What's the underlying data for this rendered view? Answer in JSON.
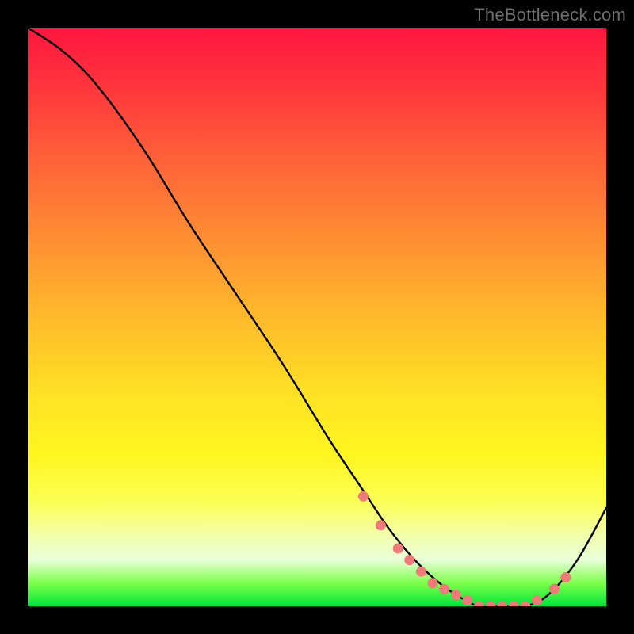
{
  "watermark": "TheBottleneck.com",
  "chart_data": {
    "type": "line",
    "title": "",
    "xlabel": "",
    "ylabel": "",
    "xlim": [
      0,
      100
    ],
    "ylim": [
      0,
      100
    ],
    "series": [
      {
        "name": "bottleneck-curve",
        "x": [
          0,
          6,
          12,
          20,
          28,
          36,
          44,
          52,
          58,
          62,
          66,
          70,
          74,
          78,
          82,
          86,
          90,
          95,
          100
        ],
        "values": [
          100,
          96,
          90,
          79,
          66,
          54,
          42,
          29,
          20,
          14,
          9,
          5,
          2,
          0,
          0,
          0,
          2,
          8,
          17
        ]
      }
    ],
    "markers": {
      "name": "highlight-dots",
      "color": "#f07a7a",
      "x": [
        58,
        61,
        64,
        66,
        68,
        70,
        72,
        74,
        76,
        78,
        80,
        82,
        84,
        86,
        88,
        91,
        93
      ],
      "values": [
        19,
        14,
        10,
        8,
        6,
        4,
        3,
        2,
        1,
        0,
        0,
        0,
        0,
        0,
        1,
        3,
        5
      ]
    },
    "background_gradient": {
      "top": "#ff163f",
      "bottom": "#00e63b"
    }
  }
}
